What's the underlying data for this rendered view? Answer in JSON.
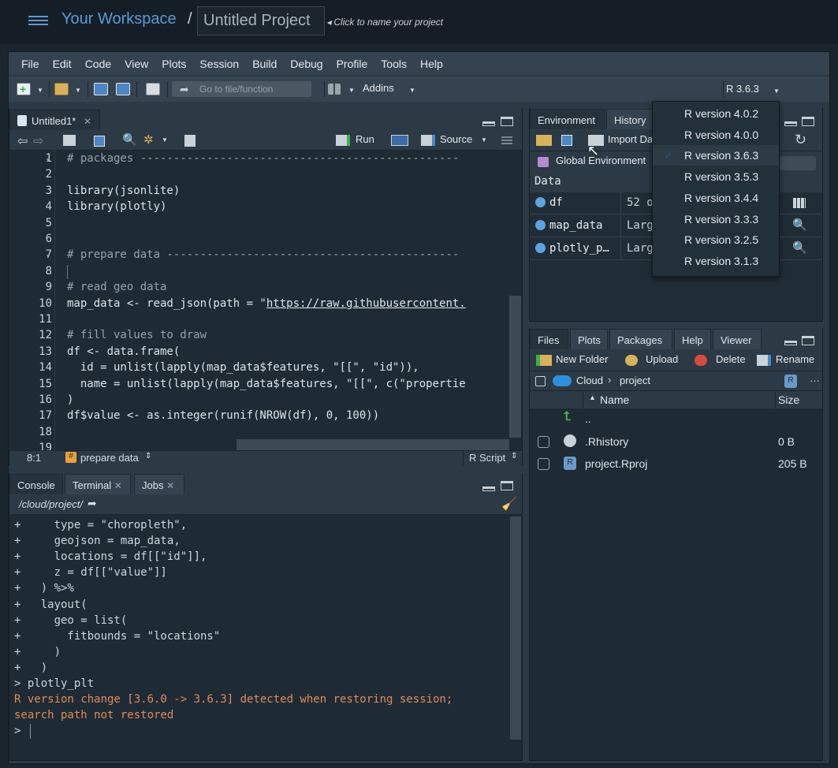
{
  "header": {
    "workspace": "Your Workspace",
    "separator": "/",
    "project": "Untitled Project",
    "hint": "Click to name your project"
  },
  "menu": [
    "File",
    "Edit",
    "Code",
    "View",
    "Plots",
    "Session",
    "Build",
    "Debug",
    "Profile",
    "Tools",
    "Help"
  ],
  "toolbar": {
    "goto_placeholder": "Go to file/function",
    "addins": "Addins",
    "r_version": "R 3.6.3"
  },
  "editor": {
    "tab": "Untitled1*",
    "run": "Run",
    "source": "Source",
    "lines": [
      {
        "n": "1",
        "t": "# packages ------------------------------------------------",
        "fold": true
      },
      {
        "n": "2",
        "t": ""
      },
      {
        "n": "3",
        "t": "library(jsonlite)"
      },
      {
        "n": "4",
        "t": "library(plotly)"
      },
      {
        "n": "5",
        "t": ""
      },
      {
        "n": "6",
        "t": ""
      },
      {
        "n": "7",
        "t": "# prepare data --------------------------------------------",
        "fold": true
      },
      {
        "n": "8",
        "t": ""
      },
      {
        "n": "9",
        "t": "# read geo data"
      },
      {
        "n": "10",
        "t": "map_data <- read_json(path = \"https://raw.githubusercontent."
      },
      {
        "n": "11",
        "t": ""
      },
      {
        "n": "12",
        "t": "# fill values to draw"
      },
      {
        "n": "13",
        "t": "df <- data.frame("
      },
      {
        "n": "14",
        "t": "  id = unlist(lapply(map_data$features, \"[[\", \"id\")),"
      },
      {
        "n": "15",
        "t": "  name = unlist(lapply(map_data$features, \"[[\", c(\"propertie"
      },
      {
        "n": "16",
        "t": ")"
      },
      {
        "n": "17",
        "t": "df$value <- as.integer(runif(NROW(df), 0, 100))"
      },
      {
        "n": "18",
        "t": ""
      },
      {
        "n": "19",
        "t": ""
      }
    ],
    "status_pos": "8:1",
    "status_section": "prepare data",
    "status_type": "R Script"
  },
  "console": {
    "tabs": [
      "Console",
      "Terminal",
      "Jobs"
    ],
    "path": "/cloud/project/",
    "lines": [
      {
        "t": "+     type = \"choropleth\",",
        "w": false
      },
      {
        "t": "+     geojson = map_data,",
        "w": false
      },
      {
        "t": "+     locations = df[[\"id\"]],",
        "w": false
      },
      {
        "t": "+     z = df[[\"value\"]]",
        "w": false
      },
      {
        "t": "+   ) %>%",
        "w": false
      },
      {
        "t": "+   layout(",
        "w": false
      },
      {
        "t": "+     geo = list(",
        "w": false
      },
      {
        "t": "+       fitbounds = \"locations\"",
        "w": false
      },
      {
        "t": "+     )",
        "w": false
      },
      {
        "t": "+   )",
        "w": false
      },
      {
        "t": "> plotly_plt",
        "w": false
      },
      {
        "t": "R version change [3.6.0 -> 3.6.3] detected when restoring session;",
        "w": true
      },
      {
        "t": "search path not restored",
        "w": true
      },
      {
        "t": "> ",
        "w": false
      }
    ]
  },
  "env": {
    "tabs": [
      "Environment",
      "History"
    ],
    "import": "Import Da",
    "global": "Global Environment",
    "section": "Data",
    "rows": [
      {
        "name": "df",
        "val": "52 o"
      },
      {
        "name": "map_data",
        "val": "Larg"
      },
      {
        "name": "plotly_p…",
        "val": "Larg"
      }
    ]
  },
  "files": {
    "tabs": [
      "Files",
      "Plots",
      "Packages",
      "Help",
      "Viewer"
    ],
    "new_folder": "New Folder",
    "upload": "Upload",
    "delete": "Delete",
    "rename": "Rename",
    "crumb_root": "Cloud",
    "crumb_sub": "project",
    "col_name": "Name",
    "col_size": "Size",
    "rows": [
      {
        "name": "..",
        "size": ""
      },
      {
        "name": ".Rhistory",
        "size": "0 B"
      },
      {
        "name": "project.Rproj",
        "size": "205 B"
      }
    ]
  },
  "versions": [
    "R version 4.0.2",
    "R version 4.0.0",
    "R version 3.6.3",
    "R version 3.5.3",
    "R version 3.4.4",
    "R version 3.3.3",
    "R version 3.2.5",
    "R version 3.1.3"
  ],
  "selected_version": "R version 3.6.3"
}
